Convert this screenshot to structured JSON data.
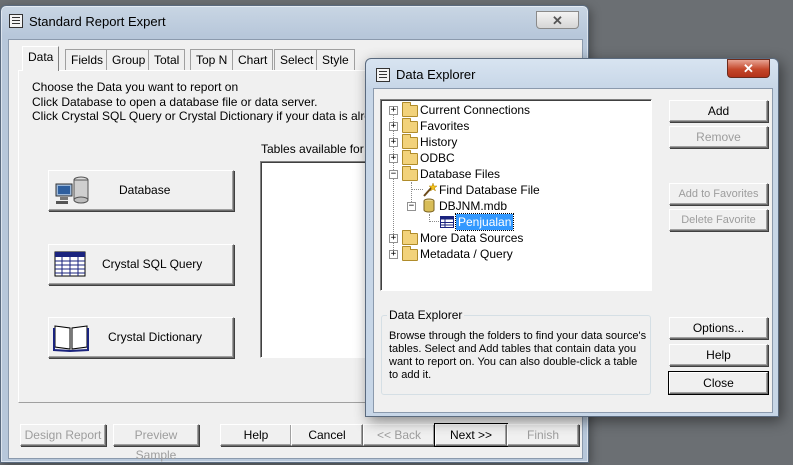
{
  "report_expert": {
    "title": "Standard Report Expert",
    "tabs": [
      "Data",
      "Fields",
      "Group",
      "Total",
      "Top N",
      "Chart",
      "Select",
      "Style"
    ],
    "instructions": [
      "Choose the Data you want to report on",
      "Click Database to open a database file or data server.",
      "Click Crystal SQL Query or Crystal Dictionary if your data is already save"
    ],
    "tables_label": "Tables available for rep",
    "source_buttons": {
      "database": "Database",
      "sql_query": "Crystal SQL Query",
      "dictionary": "Crystal Dictionary"
    },
    "footer_buttons": {
      "design_report": "Design Report",
      "preview_sample": "Preview Sample",
      "help": "Help",
      "cancel": "Cancel",
      "back": "<< Back",
      "next": "Next >>",
      "finish": "Finish"
    },
    "close_glyph": "✕"
  },
  "data_explorer": {
    "title": "Data Explorer",
    "close_glyph": "✕",
    "tree": {
      "current_connections": "Current Connections",
      "favorites": "Favorites",
      "history": "History",
      "odbc": "ODBC",
      "database_files": "Database Files",
      "find_database_file": "Find Database File",
      "dbjnm_mdb": "DBJNM.mdb",
      "penjualan": "Penjualan",
      "more_data_sources": "More Data Sources",
      "metadata_query": "Metadata / Query"
    },
    "buttons": {
      "add": "Add",
      "remove": "Remove",
      "add_to_favorites": "Add to Favorites",
      "delete_favorite": "Delete Favorite",
      "options": "Options...",
      "help": "Help",
      "close": "Close"
    },
    "info_title": "Data Explorer",
    "info_lines": [
      "Browse through the folders to find your data source's",
      "tables.  Select and Add tables that contain data you",
      "want to report on.  You can also double-click a table",
      "to add it."
    ]
  },
  "colors": {
    "selection": "#3399ff",
    "title_bar_inactive": "#b7c7da",
    "title_bar_active": "#c7d6e7",
    "disabled_text": "#9d9d9d"
  }
}
